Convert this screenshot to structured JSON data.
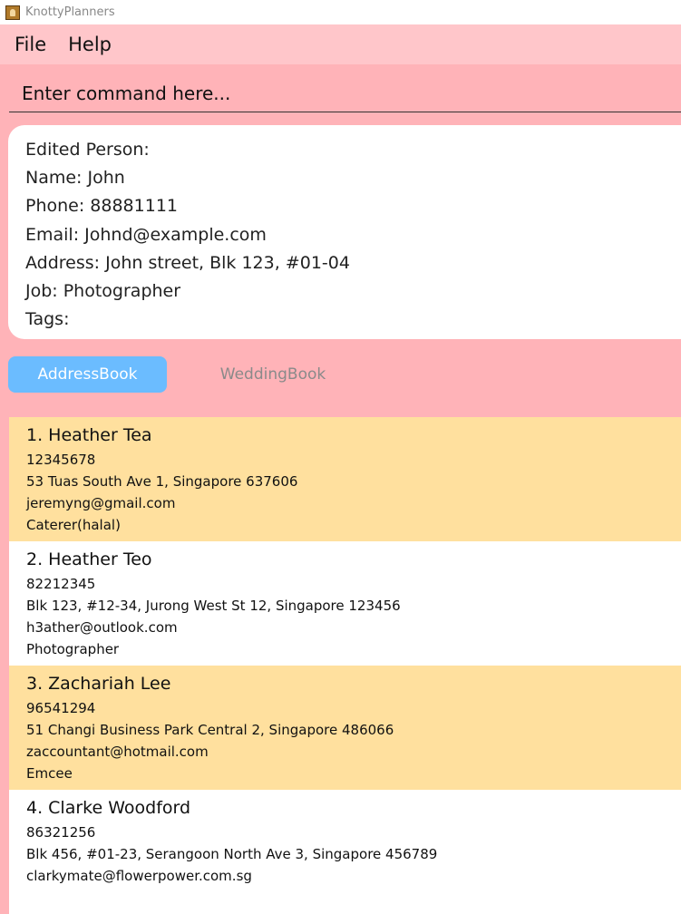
{
  "window": {
    "title": "KnottyPlanners"
  },
  "menu": {
    "file": "File",
    "help": "Help"
  },
  "command": {
    "placeholder": "Enter command here...",
    "value": ""
  },
  "result": {
    "lines": [
      "Edited Person:",
      "Name: John",
      "Phone: 88881111",
      "Email: Johnd@example.com",
      "Address: John street, Blk 123, #01-04",
      "Job: Photographer",
      "Tags:"
    ]
  },
  "tabs": [
    {
      "label": "AddressBook",
      "active": true
    },
    {
      "label": "WeddingBook",
      "active": false
    }
  ],
  "persons": [
    {
      "name": "1. Heather Tea",
      "phone": "12345678",
      "address": "53 Tuas South Ave 1, Singapore 637606",
      "email": "jeremyng@gmail.com",
      "job": "Caterer(halal)"
    },
    {
      "name": "2. Heather Teo",
      "phone": "82212345",
      "address": "Blk 123, #12-34, Jurong West St 12, Singapore 123456",
      "email": "h3ather@outlook.com",
      "job": "Photographer"
    },
    {
      "name": "3. Zachariah Lee",
      "phone": "96541294",
      "address": "51 Changi Business Park Central 2, Singapore 486066",
      "email": "zaccountant@hotmail.com",
      "job": "Emcee"
    },
    {
      "name": "4. Clarke Woodford",
      "phone": "86321256",
      "address": "Blk 456, #01-23, Serangoon North Ave 3, Singapore 456789",
      "email": "clarkymate@flowerpower.com.sg",
      "job": ""
    }
  ],
  "colors": {
    "background": "#ffb3b8",
    "menubar": "#ffc6ca",
    "tab_active": "#6bbcff",
    "card_highlight": "#ffe09e",
    "card_plain": "#ffffff"
  }
}
